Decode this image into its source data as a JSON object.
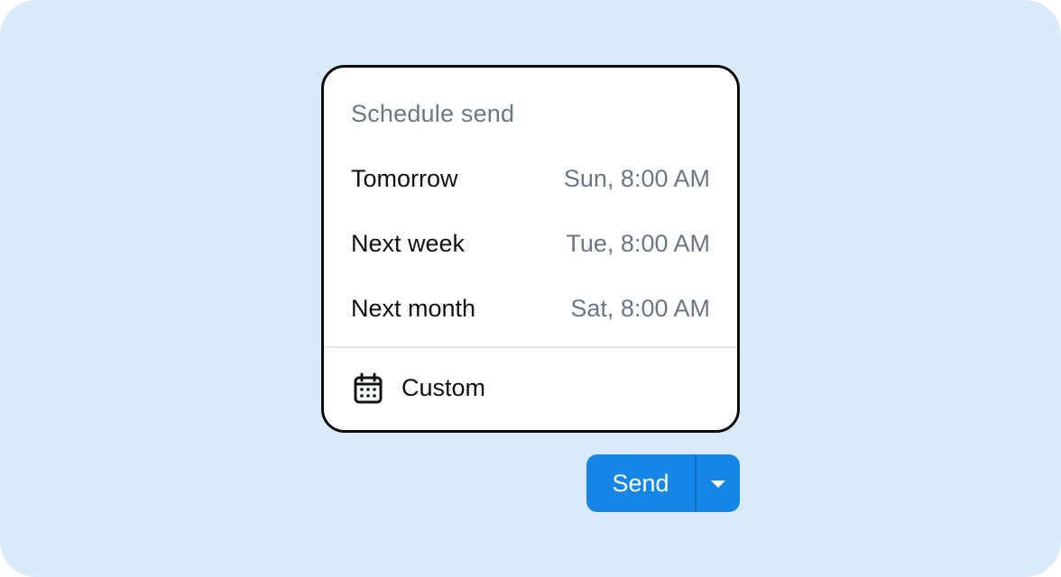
{
  "schedule_menu": {
    "title": "Schedule send",
    "options": [
      {
        "label": "Tomorrow",
        "time": "Sun, 8:00 AM"
      },
      {
        "label": "Next week",
        "time": "Tue, 8:00 AM"
      },
      {
        "label": "Next month",
        "time": "Sat, 8:00 AM"
      }
    ],
    "custom": {
      "label": "Custom",
      "icon": "calendar-icon"
    }
  },
  "send_button": {
    "label": "Send",
    "dropdown_icon": "caret-down-icon"
  },
  "colors": {
    "background": "#d9eafb",
    "accent": "#1585e6",
    "muted_text": "#6b7785",
    "text": "#0f1115"
  }
}
